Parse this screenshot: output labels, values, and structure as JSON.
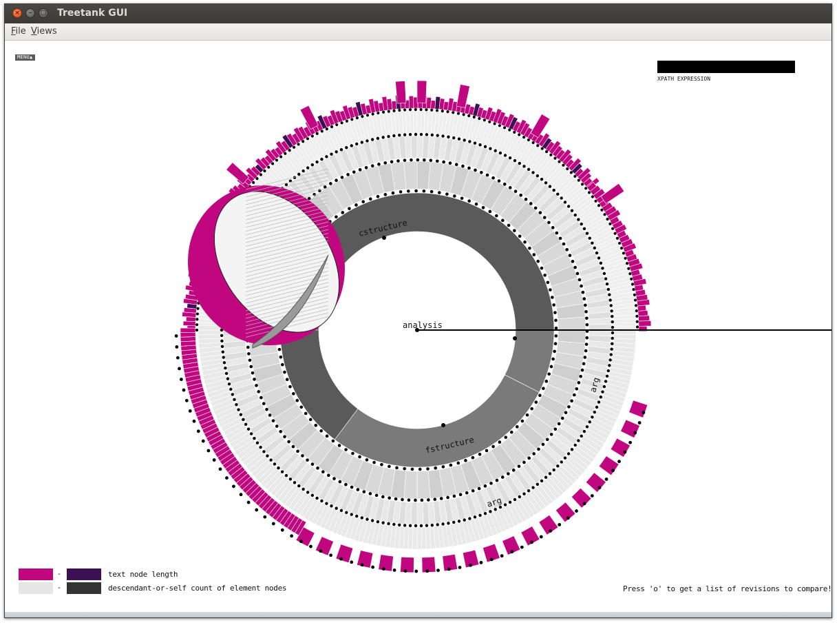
{
  "window": {
    "title": "Treetank GUI",
    "controls": {
      "close": "×",
      "minimize": "–",
      "maximize": "□"
    }
  },
  "menubar": {
    "items": [
      {
        "label": "File",
        "mnemonic": "F",
        "rest": "ile"
      },
      {
        "label": "Views",
        "mnemonic": "V",
        "rest": "iews"
      }
    ]
  },
  "canvas": {
    "menu_button": "MENU▲",
    "xpath": {
      "label": "XPATH EXPRESSION",
      "value": ""
    },
    "legend": [
      {
        "from_color": "#c0077f",
        "to_color": "#3b1055",
        "label": "text node length"
      },
      {
        "from_color": "#e6e6e6",
        "to_color": "#333333",
        "label": "descendant-or-self count of element nodes"
      }
    ],
    "hint": "Press 'o' to get a list of revisions to compare!"
  },
  "visualization": {
    "root_label": "analysis",
    "node_labels": [
      "cstructure",
      "fstructure",
      "arg",
      "arg"
    ],
    "colors": {
      "text_node": "#c0077f",
      "text_node_dark": "#3b1055",
      "inner_ring_dark": "#5a5a5a",
      "inner_ring_mid": "#7a7a7a",
      "segment_light": "#d8d8d8",
      "segment_lighter": "#e8e8e8",
      "dot": "#000000"
    }
  }
}
